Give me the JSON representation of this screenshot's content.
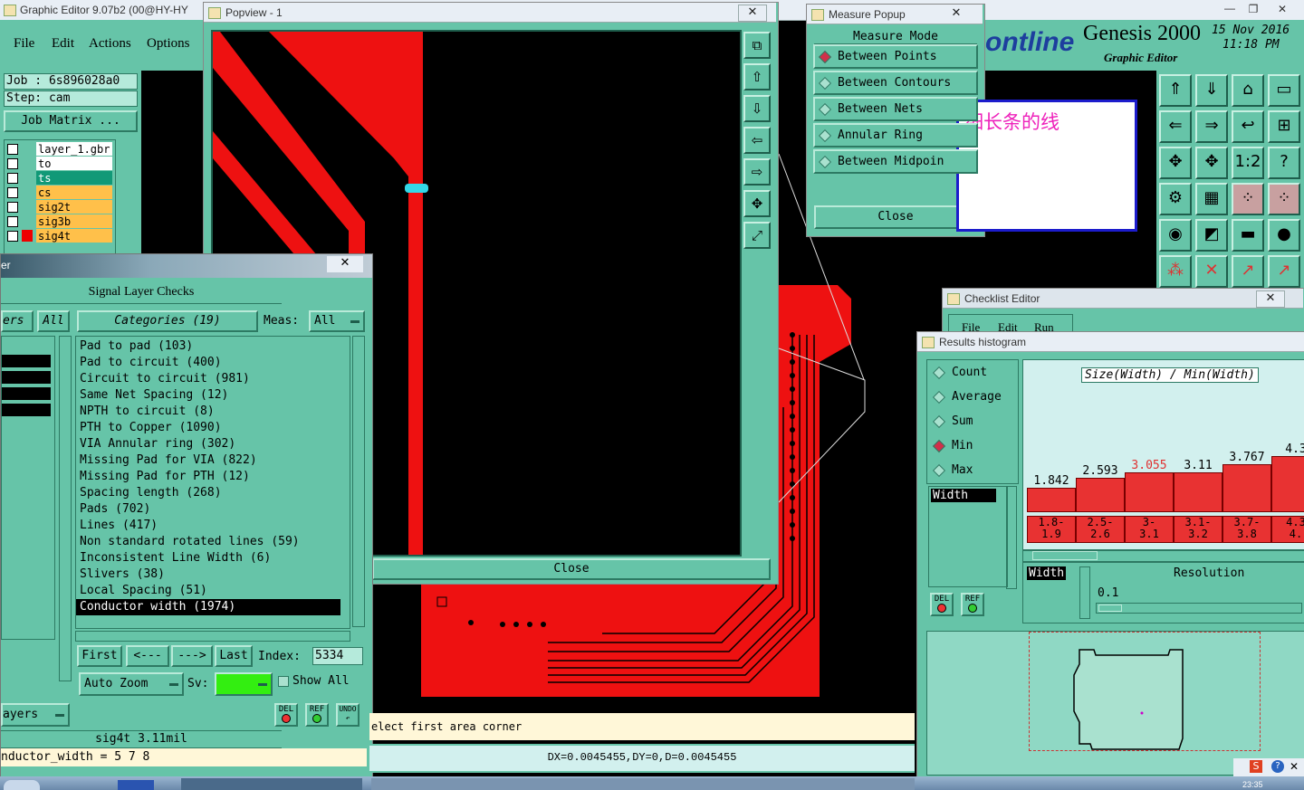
{
  "main_window": {
    "title": "Graphic Editor 9.07b2 (00@HY-HY",
    "menu": [
      "File",
      "Edit",
      "Actions",
      "Options"
    ],
    "job_label": "Job : 6s896028a0",
    "step_label": "Step: cam",
    "job_matrix_button": "Job Matrix ...",
    "layers": [
      {
        "name": "layer_1.gbr",
        "color": "#ffffff"
      },
      {
        "name": "to",
        "color": "#ffffff"
      },
      {
        "name": "ts",
        "color": "#119977"
      },
      {
        "name": "cs",
        "color": "#ffc04a"
      },
      {
        "name": "sig2t",
        "color": "#ffc04a"
      },
      {
        "name": "sig3b",
        "color": "#ffc04a"
      },
      {
        "name": "sig4t",
        "color": "#ffc04a"
      }
    ]
  },
  "brand": {
    "logo": "ontline",
    "product": "Genesis 2000",
    "subtitle": "Graphic Editor",
    "date": "15 Nov 2016",
    "time": "11:18 PM"
  },
  "popview": {
    "title": "Popview - 1",
    "close_button": "Close"
  },
  "measure_popup": {
    "title": "Measure Popup",
    "header": "Measure Mode",
    "options": [
      "Between Points",
      "Between Contours",
      "Between Nets",
      "Annular Ring",
      "Between Midpoin"
    ],
    "selected_index": 0,
    "close_button": "Close"
  },
  "annotation_note": "细长条的线",
  "checks_panel": {
    "partial_title": "er",
    "title": "Signal Layer Checks",
    "left_tab": "ers",
    "left_all": "All",
    "categories_label": "Categories (19)",
    "meas_label": "Meas:",
    "meas_value": "All",
    "categories": [
      "Pad to pad (103)",
      "Pad to circuit (400)",
      "Circuit to circuit (981)",
      "Same Net Spacing (12)",
      "NPTH to circuit (8)",
      "PTH to Copper (1090)",
      "VIA Annular ring (302)",
      "Missing Pad for VIA (822)",
      "Missing Pad for PTH (12)",
      "Spacing length (268)",
      "Pads (702)",
      "Lines (417)",
      "Non standard rotated lines (59)",
      "Inconsistent Line Width (6)",
      "Slivers (38)",
      "Local Spacing (51)",
      "Conductor width (1974)"
    ],
    "selected_category_index": 16,
    "nav": {
      "first": "First",
      "prev": "<---",
      "next": "--->",
      "last": "Last",
      "index_label": "Index:",
      "index_value": "5334"
    },
    "auto_zoom": "Auto Zoom",
    "sv_label": "Sv:",
    "show_all": "Show All",
    "layers_button": "ayers",
    "del": "DEL",
    "ref": "REF",
    "undo": "UNDO",
    "status_layer": "sig4t 3.11mil",
    "status_expr": "nductor_width = 5 7 8"
  },
  "prompt_text": "elect first area corner",
  "measure_readout": "DX=0.0045455,DY=0,D=0.0045455",
  "checklist_editor": {
    "title": "Checklist Editor",
    "menu": [
      "File",
      "Edit",
      "Run"
    ]
  },
  "results_histogram": {
    "title": "Results histogram",
    "stats": [
      "Count",
      "Average",
      "Sum",
      "Min",
      "Max"
    ],
    "selected_stat": "Min",
    "field_item": "Width",
    "graph_title": "Size(Width) / Min(Width)",
    "bars": [
      {
        "value": "1.842",
        "range_top": "1.8-",
        "range_bottom": "1.9",
        "highlight": false,
        "height": 0.32
      },
      {
        "value": "2.593",
        "range_top": "2.5-",
        "range_bottom": "2.6",
        "highlight": false,
        "height": 0.47
      },
      {
        "value": "3.055",
        "range_top": "3-",
        "range_bottom": "3.1",
        "highlight": true,
        "height": 0.55
      },
      {
        "value": "3.11",
        "range_top": "3.1-",
        "range_bottom": "3.2",
        "highlight": false,
        "height": 0.55
      },
      {
        "value": "3.767",
        "range_top": "3.7-",
        "range_bottom": "3.8",
        "highlight": false,
        "height": 0.66
      },
      {
        "value": "4.3",
        "range_top": "4.3",
        "range_bottom": "4.",
        "highlight": false,
        "height": 0.78
      }
    ],
    "width_label": "Width",
    "resolution_label": "Resolution",
    "resolution_value": "0.1",
    "del": "DEL",
    "ref": "REF"
  },
  "toolbar_icons": [
    "zoom-home",
    "zoom-out",
    "zoom-layers",
    "zoom-fit",
    "pan-left",
    "pan-right",
    "step-in",
    "grid",
    "center",
    "pan",
    "ratio-1-2",
    "help",
    "snap",
    "grid-view",
    "netlist",
    "netlist-red",
    "measure-point",
    "measure-line",
    "ruler",
    "pad",
    "net-a",
    "net-b",
    "net-c",
    "net-d"
  ],
  "side_icons": [
    "window-restore",
    "move-up",
    "move-down",
    "move-left",
    "move-right",
    "fit",
    "pan"
  ],
  "taskbar_time": "23:35"
}
